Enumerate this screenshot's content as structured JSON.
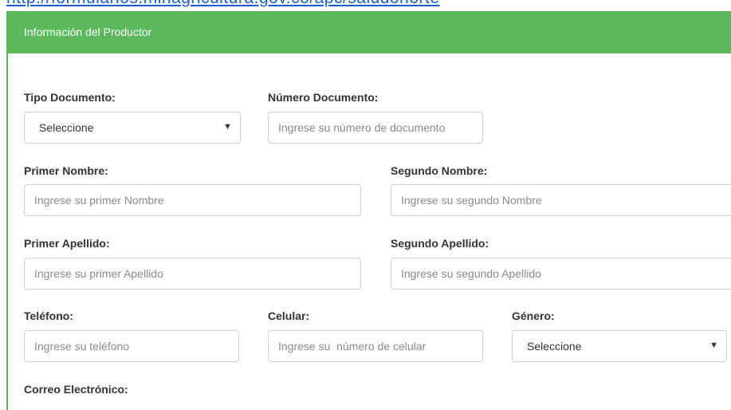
{
  "top_link": "http://formularios.minagricultura.gov.co/apc/saludonorte",
  "panel": {
    "title": "Información del Productor"
  },
  "form": {
    "tipo_documento": {
      "label": "Tipo Documento:",
      "value": "Seleccione",
      "caret": "▼"
    },
    "numero_documento": {
      "label": "Número Documento:",
      "placeholder": "Ingrese su número de documento"
    },
    "primer_nombre": {
      "label": "Primer Nombre:",
      "placeholder": "Ingrese su primer Nombre"
    },
    "segundo_nombre": {
      "label": "Segundo Nombre:",
      "placeholder": "Ingrese su segundo Nombre"
    },
    "primer_apellido": {
      "label": "Primer Apellido:",
      "placeholder": "Ingrese su primer Apellido"
    },
    "segundo_apellido": {
      "label": "Segundo Apellido:",
      "placeholder": "Ingrese su segundo Apellido"
    },
    "telefono": {
      "label": "Teléfono:",
      "placeholder": "Ingrese su teléfono"
    },
    "celular": {
      "label": "Celular:",
      "placeholder": "Ingrese su  número de celular"
    },
    "genero": {
      "label": "Género:",
      "value": "Seleccione",
      "caret": "▼"
    },
    "correo": {
      "label": "Correo Electrónico:"
    }
  },
  "colors": {
    "accent": "#5cb85c",
    "link": "#1a5fd0"
  }
}
